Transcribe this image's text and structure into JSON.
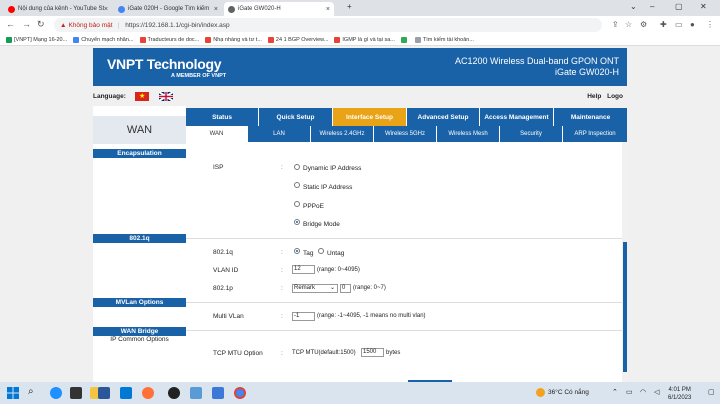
{
  "browser": {
    "tabs": [
      {
        "title": "Nội dung của kênh - YouTube St",
        "favicon_color": "#ff0000"
      },
      {
        "title": "iGate 020H - Google Tìm kiếm",
        "favicon_color": "#4285f4"
      },
      {
        "title": "iGate GW020-H",
        "favicon_color": "#5f6368"
      }
    ],
    "active_tab": 2,
    "address": {
      "warning": "Không bảo mật",
      "url": "https://192.168.1.1/cgi-bin/index.asp"
    },
    "bookmarks": [
      {
        "label": "[VNPT] Mạng 16-20...",
        "color": "#0f9d58"
      },
      {
        "label": "Chuyển mạch nhân...",
        "color": "#4285f4"
      },
      {
        "label": "Traducteurs de doc...",
        "color": "#ea4335"
      },
      {
        "label": "Nhạ nhàng và tư t...",
        "color": "#ea4335"
      },
      {
        "label": "24 1 BGP Overview...",
        "color": "#ea4335"
      },
      {
        "label": "IGMP là gì và tại sa...",
        "color": "#ea4335"
      },
      {
        "label": "",
        "color": "#34a853"
      },
      {
        "label": "Tìm kiếm tài khoản...",
        "color": "#9aa0a6"
      }
    ]
  },
  "router": {
    "logo": "VNPT Technology",
    "logo_sub": "A MEMBER OF VNPT",
    "product_line1": "AC1200 Wireless Dual-band GPON ONT",
    "product_line2": "iGate GW020-H",
    "language_label": "Language:",
    "help": "Help",
    "logout": "Logo",
    "main_tabs": [
      "Status",
      "Quick Setup",
      "Interface Setup",
      "Advanced Setup",
      "Access Management",
      "Maintenance"
    ],
    "main_active": "Interface Setup",
    "sub_tabs": [
      "WAN",
      "LAN",
      "Wireless 2.4GHz",
      "Wireless 5GHz",
      "Wireless Mesh",
      "Security",
      "ARP Inspection"
    ],
    "sub_active": "WAN",
    "sidebar": {
      "title": "WAN",
      "sections": [
        "Encapsulation",
        "802.1q",
        "MVLan Options",
        "WAN Bridge"
      ],
      "ip_common": "IP Common Options"
    },
    "form": {
      "isp_label": "ISP",
      "isp_options": [
        "Dynamic IP Address",
        "Static IP Address",
        "PPPoE",
        "Bridge Mode"
      ],
      "isp_selected": "Bridge Mode",
      "dot1q_label": "802.1q",
      "tag": "Tag",
      "untag": "Untag",
      "tag_selected": "Tag",
      "vlan_id_label": "VLAN ID",
      "vlan_id_value": "12",
      "vlan_id_hint": "(range: 0~4095)",
      "dot1p_label": "802.1p",
      "dot1p_select": "Remark",
      "dot1p_value": "0",
      "dot1p_hint": "(range: 0~7)",
      "multi_vlan_label": "Multi VLan",
      "multi_vlan_value": "-1",
      "multi_vlan_hint": "(range: -1~4095, -1 means no multi vlan)",
      "tcp_mtu_label": "TCP MTU Option",
      "tcp_mtu_text": "TCP MTU(default:1500)",
      "tcp_mtu_value": "1500",
      "tcp_mtu_unit": "bytes"
    }
  },
  "taskbar": {
    "weather": "36°C  Có nắng",
    "time": "4:01 PM",
    "date": "6/1/2023"
  }
}
